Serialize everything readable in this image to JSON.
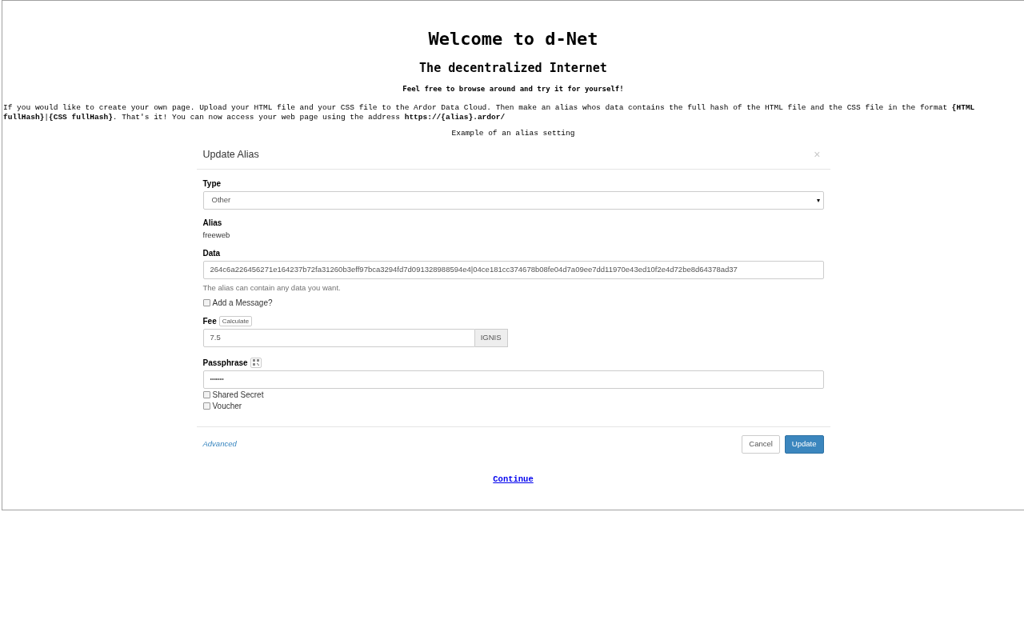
{
  "title": "Welcome to d-Net",
  "subtitle": "The decentralized Internet",
  "tagline": "Feel free to browse around and try it for yourself!",
  "instructions": "If you would like to create your own page. Upload your HTML file and your CSS file to the Ardor Data Cloud. Then make an alias whos data contains the full hash of the HTML file and the CSS file in the format **{HTML fullHash}**|**{CSS fullHash}**. That's it! You can now access your web page using the address **https://{alias}.ardor/**",
  "example_caption": "Example of an alias setting",
  "dialog": {
    "title": "Update Alias",
    "close": "×",
    "type": {
      "label": "Type",
      "value": "Other",
      "caret": "▾"
    },
    "alias": {
      "label": "Alias",
      "value": "freeweb"
    },
    "data": {
      "label": "Data",
      "value": "264c6a226456271e164237b72fa31260b3eff97bca3294fd7d091328988594e4|04ce181cc374678b08fe04d7a09ee7dd11970e43ed10f2e4d72be8d64378ad37",
      "help": "The alias can contain any data you want."
    },
    "add_message": {
      "label": "Add a Message?",
      "checked": false
    },
    "fee": {
      "label": "Fee",
      "calculate": "Calculate",
      "value": "7.5",
      "unit": "IGNIS"
    },
    "passphrase": {
      "label": "Passphrase",
      "value": "•••••••"
    },
    "options": [
      {
        "label": "Shared Secret",
        "checked": false
      },
      {
        "label": "Voucher",
        "checked": false
      }
    ],
    "advanced": "Advanced",
    "buttons": [
      {
        "label": "Cancel",
        "kind": "default"
      },
      {
        "label": "Update",
        "kind": "primary"
      }
    ]
  },
  "continue": "Continue"
}
